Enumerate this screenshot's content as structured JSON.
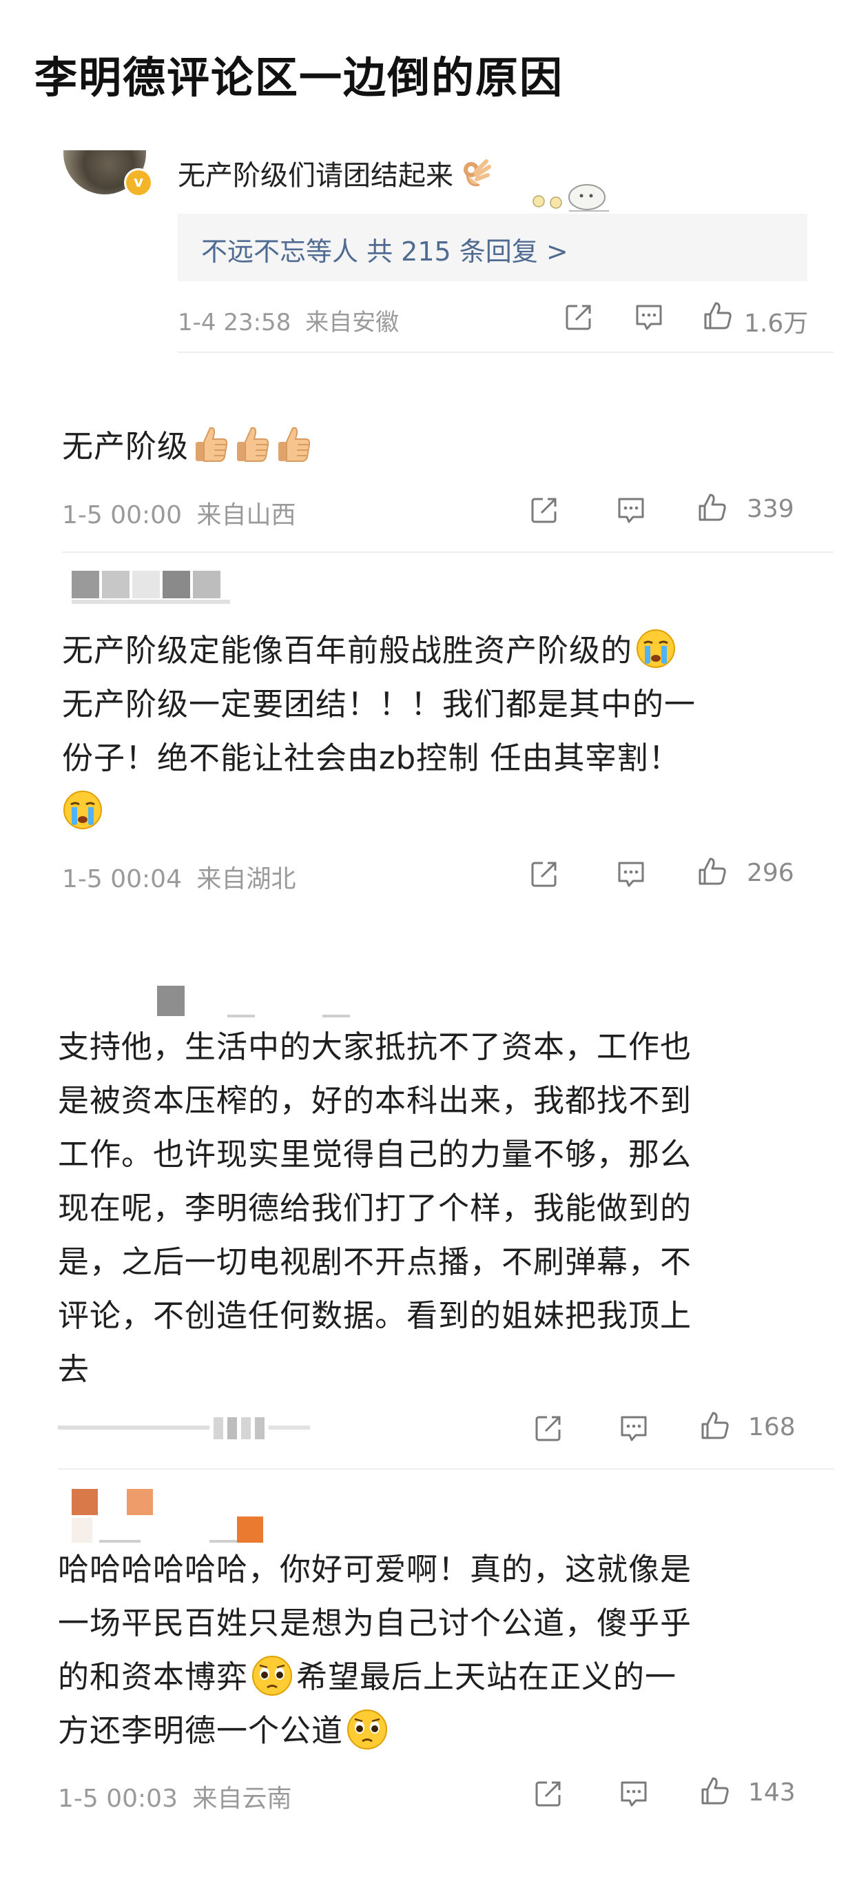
{
  "headline": "李明德评论区一边倒的原因",
  "comments": [
    {
      "text": "无产阶级们请团结起来",
      "reply_summary": "不远不忘等人 共 215 条回复 >",
      "date": "1-4 23:58",
      "location": "来自安徽",
      "likes": "1.6万"
    },
    {
      "text": "无产阶级",
      "date": "1-5 00:00",
      "location": "来自山西",
      "likes": "339"
    },
    {
      "lines": [
        "无产阶级定能像百年前般战胜资产阶级的",
        "无产阶级一定要团结！！！我们都是其中的一",
        "份子！绝不能让社会由zb控制 任由其宰割！"
      ],
      "date": "1-5 00:04",
      "location": "来自湖北",
      "likes": "296"
    },
    {
      "lines": [
        "支持他，生活中的大家抵抗不了资本，工作也",
        "是被资本压榨的，好的本科出来，我都找不到",
        "工作。也许现实里觉得自己的力量不够，那么",
        "现在呢，李明德给我们打了个样，我能做到的",
        "是，之后一切电视剧不开点播，不刷弹幕，不",
        "评论，不创造任何数据。看到的姐妹把我顶上",
        "去"
      ],
      "likes": "168"
    },
    {
      "lines": [
        "哈哈哈哈哈哈，你好可爱啊！真的，这就像是",
        "一场平民百姓只是想为自己讨个公道，傻乎乎",
        "的和资本博弈",
        "希望最后上天站在正义的一",
        "方还李明德一个公道"
      ],
      "date": "1-5 00:03",
      "location": "来自云南",
      "likes": "143"
    }
  ],
  "icons": {
    "share": "share-icon",
    "comment": "comment-icon",
    "like": "like-icon"
  },
  "colors": {
    "link": "#506b92",
    "meta": "#9a9a9a",
    "reply_bg": "#f5f5f5"
  }
}
